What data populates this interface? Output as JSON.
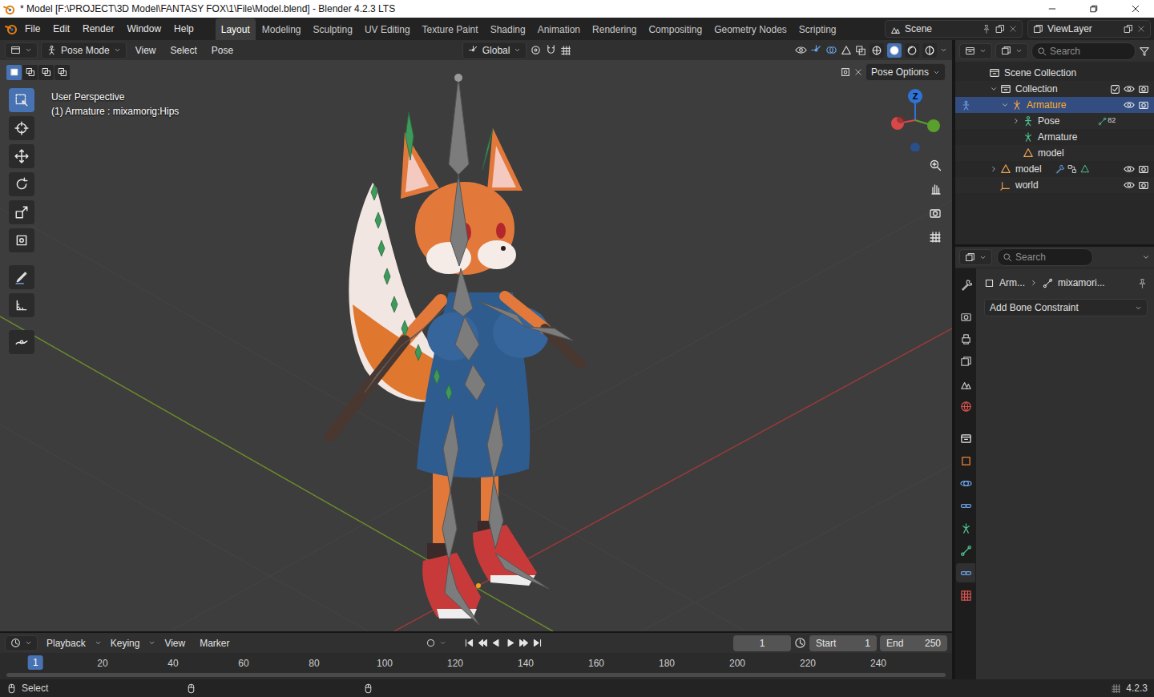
{
  "window": {
    "title": "* Model [F:\\PROJECT\\3D Model\\FANTASY FOX\\1\\File\\Model.blend] - Blender 4.2.3 LTS"
  },
  "menu": [
    "File",
    "Edit",
    "Render",
    "Window",
    "Help"
  ],
  "workspaces": [
    {
      "label": "Layout",
      "selected": true
    },
    {
      "label": "Modeling",
      "selected": false
    },
    {
      "label": "Sculpting",
      "selected": false
    },
    {
      "label": "UV Editing",
      "selected": false
    },
    {
      "label": "Texture Paint",
      "selected": false
    },
    {
      "label": "Shading",
      "selected": false
    },
    {
      "label": "Animation",
      "selected": false
    },
    {
      "label": "Rendering",
      "selected": false
    },
    {
      "label": "Compositing",
      "selected": false
    },
    {
      "label": "Geometry Nodes",
      "selected": false
    },
    {
      "label": "Scripting",
      "selected": false
    }
  ],
  "scene": "Scene",
  "view_layer": "ViewLayer",
  "viewport": {
    "mode": "Pose Mode",
    "menus": [
      "View",
      "Select",
      "Pose"
    ],
    "orientation": "Global",
    "pose_options": "Pose Options",
    "perspective": "User Perspective",
    "active": "(1) Armature : mixamorig:Hips",
    "gizmo_axis": "Z",
    "select_modes": [
      {
        "selected": true
      },
      {
        "selected": false
      },
      {
        "selected": false
      },
      {
        "selected": false
      }
    ],
    "tools": [
      {
        "kind": "select",
        "selected": true
      },
      {
        "kind": "cursor",
        "selected": false
      },
      {
        "kind": "move",
        "selected": false
      },
      {
        "kind": "rotate",
        "selected": false
      },
      {
        "kind": "scale",
        "selected": false
      },
      {
        "kind": "transform",
        "selected": false
      },
      {
        "kind": "annotate",
        "selected": false
      },
      {
        "kind": "measure",
        "selected": false
      },
      {
        "kind": "relax",
        "selected": false
      }
    ],
    "shading": [
      {
        "kind": "wireframe",
        "selected": false
      },
      {
        "kind": "solid",
        "selected": true
      },
      {
        "kind": "material",
        "selected": false
      },
      {
        "kind": "rendered",
        "selected": false
      }
    ]
  },
  "outliner": {
    "search": {
      "placeholder": "Search"
    },
    "items": [
      {
        "label": "Scene Collection",
        "kind": "scene_collection",
        "depth": 0,
        "expandable": false,
        "expanded": false,
        "selected": false
      },
      {
        "label": "Collection",
        "kind": "collection",
        "depth": 1,
        "expandable": true,
        "expanded": true,
        "selected": false,
        "checked": true,
        "visible": true,
        "renderable": true
      },
      {
        "label": "Armature",
        "kind": "armature",
        "depth": 2,
        "expandable": true,
        "expanded": true,
        "selected": true,
        "visible": true,
        "renderable": true
      },
      {
        "label": "Pose",
        "kind": "pose",
        "depth": 3,
        "expandable": true,
        "expanded": false,
        "selected": false,
        "badge": "82"
      },
      {
        "label": "Armature",
        "kind": "armature_data",
        "depth": 3,
        "expandable": false,
        "expanded": false,
        "selected": false
      },
      {
        "label": "model",
        "kind": "mesh_data",
        "depth": 3,
        "expandable": false,
        "expanded": false,
        "selected": false
      },
      {
        "label": "model",
        "kind": "object",
        "depth": 1,
        "expandable": true,
        "expanded": false,
        "selected": false,
        "visible": true,
        "renderable": true
      },
      {
        "label": "world",
        "kind": "world",
        "depth": 1,
        "expandable": false,
        "expanded": false,
        "selected": false,
        "visible": true,
        "renderable": true
      }
    ]
  },
  "properties": {
    "search": {
      "placeholder": "Search"
    },
    "breadcrumb": [
      "Arm...",
      "mixamori..."
    ],
    "add_constraint": "Add Bone Constraint",
    "tabs": [
      {
        "kind": "tool",
        "selected": false
      },
      {
        "kind": "render",
        "selected": false
      },
      {
        "kind": "output",
        "selected": false
      },
      {
        "kind": "view_layer",
        "selected": false
      },
      {
        "kind": "scene",
        "selected": false
      },
      {
        "kind": "world",
        "selected": false
      },
      {
        "kind": "collection",
        "selected": false
      },
      {
        "kind": "object",
        "selected": false
      },
      {
        "kind": "physics",
        "selected": false
      },
      {
        "kind": "object_constraint",
        "selected": false
      },
      {
        "kind": "armature_data",
        "selected": false
      },
      {
        "kind": "bone",
        "selected": false
      },
      {
        "kind": "bone_constraint",
        "selected": true
      },
      {
        "kind": "texture",
        "selected": false
      }
    ]
  },
  "timeline": {
    "menus": [
      "Playback",
      "Keying",
      "View",
      "Marker"
    ],
    "frame": "1",
    "start_label": "Start",
    "start": "1",
    "end_label": "End",
    "end": "250",
    "playhead": "1",
    "ticks": [
      "20",
      "40",
      "60",
      "80",
      "100",
      "120",
      "140",
      "160",
      "180",
      "200",
      "220",
      "240"
    ]
  },
  "status_bar": {
    "hint": "Select",
    "version": "4.2.3"
  }
}
